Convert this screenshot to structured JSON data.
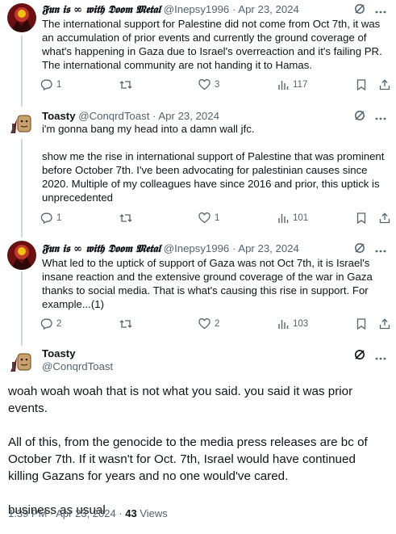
{
  "tweets": [
    {
      "name": "𝕱𝖚𝖓 𝖎𝖘 ∞ 𝖜𝖎𝖙𝖍 𝕯𝖔𝖔𝖒 𝕸𝖊𝖙𝖆𝖑",
      "handle": "@Inepsy1996",
      "dot": "·",
      "date": "Apr 23, 2024",
      "text": "The international support for Palestine did not come from Oct 7th, it was an accumulation of prior events and currently the ground coverage of what's happening in  Gaza due to Israel's overreaction and it's failing PR. The international community are not handing it to Hamas.",
      "replies": "1",
      "reposts": "",
      "likes": "3",
      "views": "117"
    },
    {
      "name": "Toasty",
      "handle": "@ConqrdToast",
      "dot": "·",
      "date": "Apr 23, 2024",
      "text_1": "i'm gonna bang my head into a damn wall jfc.",
      "text_2": "show me the rise in international support of Palestine that was prominent before October 7th. I've been advocating for palestinian causes since 2020. Multiple of my colleagues have since 2016 and prior, this uptick is unprecedented",
      "replies": "1",
      "reposts": "",
      "likes": "1",
      "views": "101"
    },
    {
      "name": "𝕱𝖚𝖓 𝖎𝖘 ∞ 𝖜𝖎𝖙𝖍 𝕯𝖔𝖔𝖒 𝕸𝖊𝖙𝖆𝖑",
      "handle": "@Inepsy1996",
      "dot": "·",
      "date": "Apr 23, 2024",
      "text": "What led to the uptick of support of Gaza was not Oct 7th, it is Israel's insane reaction and the extensive ground coverage of the war in Gaza thanks to social media. That is what's causing this rise in support. For example...(1)",
      "replies": "2",
      "reposts": "",
      "likes": "2",
      "views": "103"
    }
  ],
  "main": {
    "name": "Toasty",
    "handle": "@ConqrdToast",
    "para_1": "woah woah woah that is not what you said. you said it was prior events.",
    "para_2": "All of this, from the genocide to the media press releases are bc of October 7th. If it wasn't for Oct. 7th, Israel would have continued killing Gazans for years and no one would've cared.",
    "para_3": "business as usual",
    "timestamp": "1:39 PM · Apr 23, 2024 · ",
    "views_count": "43",
    "views_label": "Views"
  },
  "icons": {
    "reply": "reply-icon",
    "repost": "repost-icon",
    "like": "heart-icon",
    "views": "views-icon",
    "bookmark": "bookmark-icon",
    "share": "share-icon",
    "grok": "grok-icon",
    "more": "more-icon"
  },
  "colors": {
    "text": "#0f1419",
    "secondary": "#536471",
    "thread_line": "#cfd9de"
  }
}
